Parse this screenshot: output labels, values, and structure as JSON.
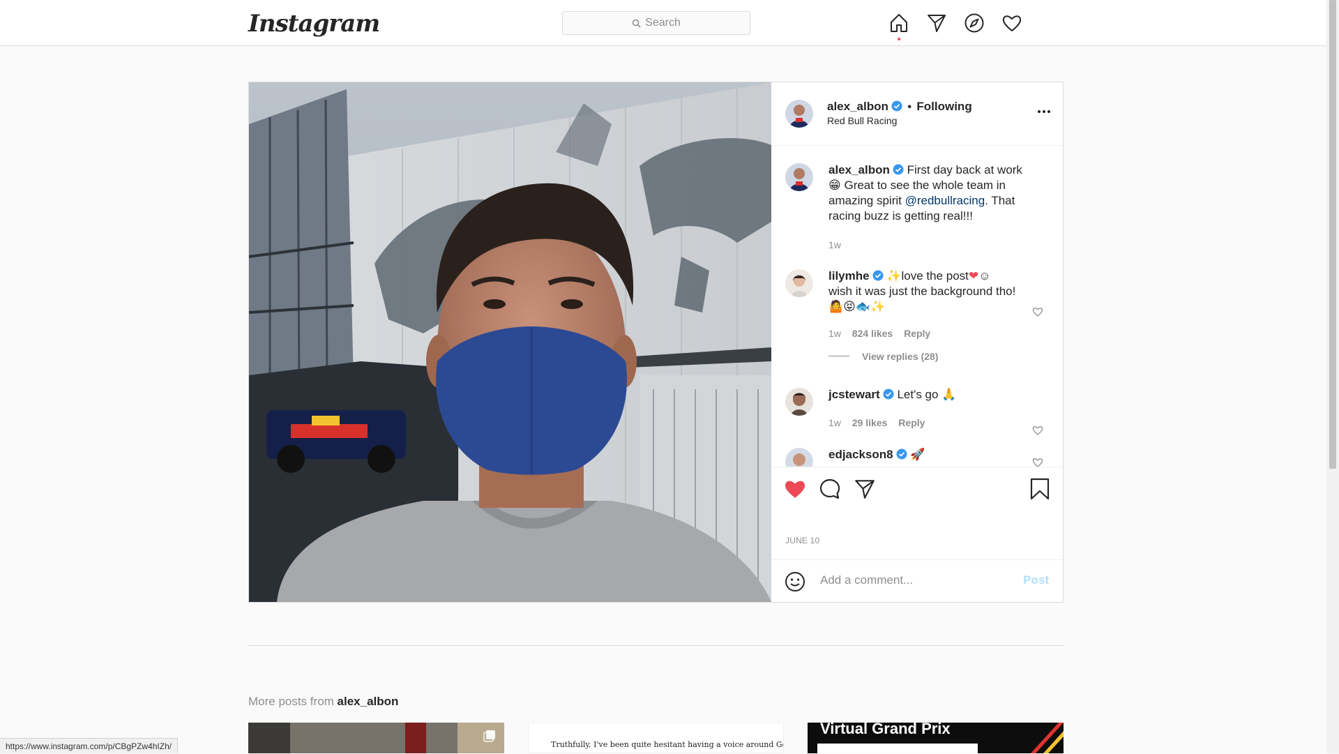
{
  "nav": {
    "logo": "Instagram",
    "search_placeholder": "Search",
    "icons": [
      "home-icon",
      "direct-icon",
      "explore-icon",
      "activity-heart-icon"
    ]
  },
  "post": {
    "header": {
      "username": "alex_albon",
      "separator": "•",
      "following": "Following",
      "location": "Red Bull Racing"
    },
    "caption": {
      "username": "alex_albon",
      "text_1": "First day back at work",
      "text_2": "Great to see the whole team in amazing spirit",
      "mention": "@redbullracing",
      "text_3": ". That racing buzz is getting real!!!",
      "time": "1w"
    },
    "comments": [
      {
        "username": "lilymhe",
        "text_1": "love the post",
        "text_2": "wish it was just the background tho!",
        "time": "1w",
        "likes": "824 likes",
        "reply": "Reply",
        "view_replies": "View replies (28)"
      },
      {
        "username": "jcstewart",
        "text": "Let's go",
        "time": "1w",
        "likes": "29 likes",
        "reply": "Reply"
      },
      {
        "username": "edjackson8",
        "text": ""
      }
    ],
    "date": "JUNE 10",
    "add_comment_placeholder": "Add a comment...",
    "post_button": "Post",
    "liked": true
  },
  "more_posts": {
    "prefix": "More posts from",
    "username": "alex_albon",
    "thumb2_text": "Truthfully, I've been quite hesitant having a voice around George",
    "thumb3_text": "Virtual Grand Prix"
  },
  "status_url": "https://www.instagram.com/p/CBgPZw4hIZh/",
  "colors": {
    "like_red": "#ed4956",
    "verified_blue": "#3897f0",
    "mask_blue": "#2c4a94"
  }
}
